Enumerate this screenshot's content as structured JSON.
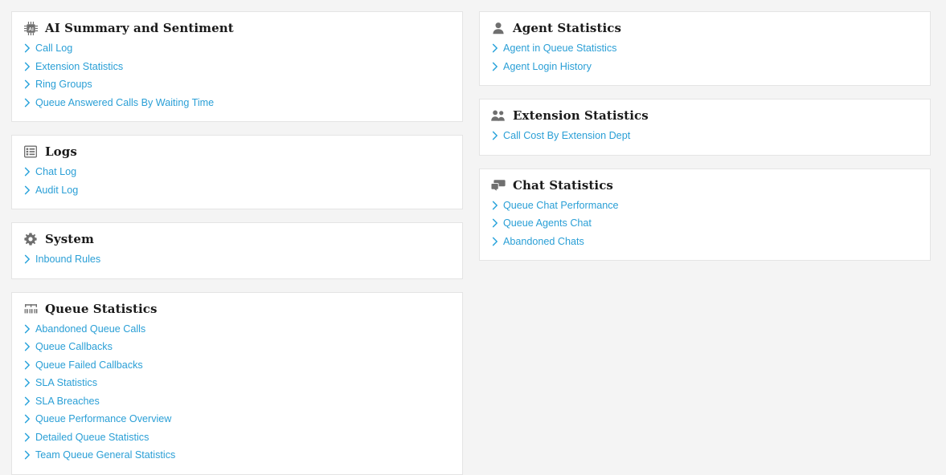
{
  "theme": {
    "page_background": "#f4f4f4",
    "card_background": "#ffffff",
    "card_border": "#e4e4e4",
    "link_color": "#2a9fd6",
    "chevron_color": "#28a3db",
    "heading_color": "#1a1a1a",
    "icon_color": "#6f6f6f"
  },
  "columns": {
    "left": [
      {
        "id": "ai-summary-and-sentiment",
        "icon": "microchip-ai-icon",
        "title": "AI Summary and Sentiment",
        "links": [
          {
            "label": "Call Log"
          },
          {
            "label": "Extension Statistics"
          },
          {
            "label": "Ring Groups"
          },
          {
            "label": "Queue Answered Calls By Waiting Time"
          }
        ]
      },
      {
        "id": "logs",
        "icon": "list-table-icon",
        "title": "Logs",
        "links": [
          {
            "label": "Chat Log"
          },
          {
            "label": "Audit Log"
          }
        ]
      },
      {
        "id": "system",
        "icon": "gear-icon",
        "title": "System",
        "links": [
          {
            "label": "Inbound Rules"
          }
        ]
      },
      {
        "id": "queue-statistics",
        "icon": "bar-chart-icon",
        "title": "Queue Statistics",
        "links": [
          {
            "label": "Abandoned Queue Calls"
          },
          {
            "label": "Queue Callbacks"
          },
          {
            "label": "Queue Failed Callbacks"
          },
          {
            "label": "SLA Statistics"
          },
          {
            "label": "SLA Breaches"
          },
          {
            "label": "Queue Performance Overview"
          },
          {
            "label": "Detailed Queue Statistics"
          },
          {
            "label": "Team Queue General Statistics"
          }
        ]
      }
    ],
    "right": [
      {
        "id": "agent-statistics",
        "icon": "person-icon",
        "title": "Agent Statistics",
        "links": [
          {
            "label": "Agent in Queue Statistics"
          },
          {
            "label": "Agent Login History"
          }
        ]
      },
      {
        "id": "extension-statistics",
        "icon": "people-icon",
        "title": "Extension Statistics",
        "links": [
          {
            "label": "Call Cost By Extension Dept"
          }
        ]
      },
      {
        "id": "chat-statistics",
        "icon": "chat-bubbles-icon",
        "title": "Chat Statistics",
        "links": [
          {
            "label": "Queue Chat Performance"
          },
          {
            "label": "Queue Agents Chat"
          },
          {
            "label": "Abandoned Chats"
          }
        ]
      }
    ]
  }
}
